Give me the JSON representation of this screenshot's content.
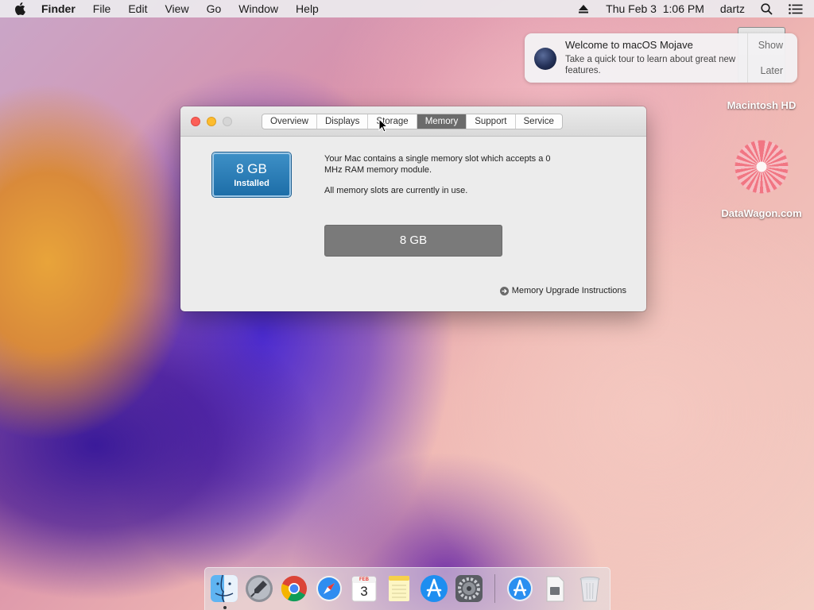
{
  "menubar": {
    "apple_icon": "apple-icon",
    "app_name": "Finder",
    "menus": [
      "File",
      "Edit",
      "View",
      "Go",
      "Window",
      "Help"
    ],
    "datetime": "Thu Feb 3  1:06 PM",
    "user": "dartz"
  },
  "notification": {
    "title": "Welcome to macOS Mojave",
    "body": "Take a quick tour to learn about great new features.",
    "show_label": "Show",
    "later_label": "Later"
  },
  "desktop": {
    "drive_label": "Macintosh HD",
    "site_label": "DataWagon.com"
  },
  "window": {
    "tabs": [
      "Overview",
      "Displays",
      "Storage",
      "Memory",
      "Support",
      "Service"
    ],
    "active_tab": "Memory",
    "installed_amount": "8 GB",
    "installed_label": "Installed",
    "description_line": "Your Mac contains a single memory slot which accepts a 0 MHz RAM memory module.",
    "slots_status": "All memory slots are currently in use.",
    "slot_value": "8 GB",
    "upgrade_link": "Memory Upgrade Instructions"
  },
  "dock": {
    "items": [
      "finder-icon",
      "launchpad-icon",
      "chrome-icon",
      "safari-icon",
      "calendar-icon",
      "notes-icon",
      "app-store-icon",
      "system-preferences-icon",
      "app-store-downloads-icon",
      "document-icon",
      "trash-icon"
    ],
    "calendar_month": "FEB",
    "calendar_day": "3"
  }
}
